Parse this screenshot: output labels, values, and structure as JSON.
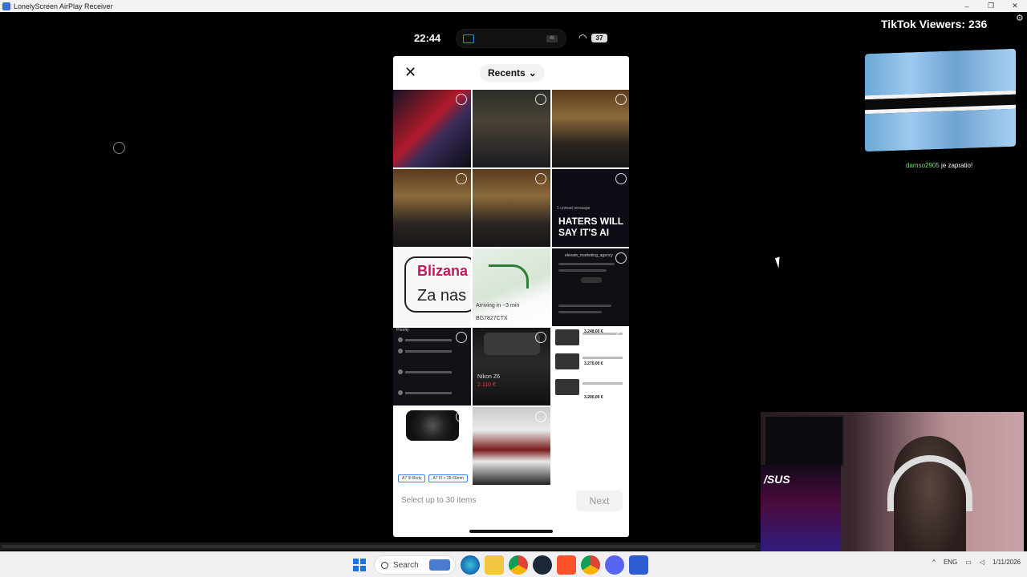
{
  "window": {
    "title": "LonelyScreen AirPlay Receiver",
    "controls": [
      "–",
      "❐",
      "✕"
    ]
  },
  "phone_status": {
    "time": "22:44",
    "battery": "37",
    "island_badge": "4k"
  },
  "picker": {
    "close_icon": "close-icon",
    "album_label": "Recents",
    "album_chevron": "⌄",
    "footer_text": "Select up to 30 items",
    "next_label": "Next",
    "tiles": [
      {
        "kind": "club",
        "name": "photo-club"
      },
      {
        "kind": "group",
        "name": "photo-group"
      },
      {
        "kind": "selfie",
        "name": "photo-selfie-1"
      },
      {
        "kind": "selfie",
        "name": "photo-selfie-2"
      },
      {
        "kind": "selfie",
        "name": "photo-selfie-3"
      },
      {
        "kind": "dark",
        "name": "screenshot-haters",
        "text1": "1 unread message",
        "text2": "HATERS WILL SAY IT'S AI"
      },
      {
        "kind": "text",
        "name": "screenshot-blizanac",
        "text1": "Blizana",
        "text2": "Za nas"
      },
      {
        "kind": "map",
        "name": "screenshot-map",
        "text1": "Arriving in ~3 min",
        "text2": "BG7827CTX"
      },
      {
        "kind": "ig",
        "name": "screenshot-profile",
        "text1": "elevate_marketing_agency"
      },
      {
        "kind": "dm",
        "name": "screenshot-dms",
        "text1": "Priority"
      },
      {
        "kind": "cam",
        "name": "screenshot-camera",
        "text1": "Nikon Z6",
        "text2": "2.110 €"
      },
      {
        "kind": "list",
        "name": "screenshot-listings",
        "text1": "3.248,00 €",
        "text2": "3.270,00 €",
        "text3": "3.200,00 €"
      },
      {
        "kind": "lens",
        "name": "screenshot-lens",
        "text1": "A7 III Body",
        "text2": "A7 III + 28-60mm"
      },
      {
        "kind": "car",
        "name": "photo-car"
      },
      {
        "kind": "empty",
        "name": "empty-cell"
      }
    ]
  },
  "overlay": {
    "viewers_text": "TikTok Viewers: 236",
    "follow_user": "damso2905",
    "follow_text": " je zapratio!",
    "flag_colors": {
      "blue": "#6da8d8",
      "white": "#f4f4f4",
      "black": "#0b0b0b"
    }
  },
  "webcam": {
    "brand_logo": "/SUS"
  },
  "taskbar": {
    "search_label": "Search",
    "language": "ENG",
    "date": "1/11/2026",
    "apps": [
      "start",
      "search",
      "news",
      "edge",
      "file-explorer",
      "chrome",
      "steam",
      "brave",
      "chrome-2",
      "discord",
      "lonelyscreen"
    ]
  }
}
